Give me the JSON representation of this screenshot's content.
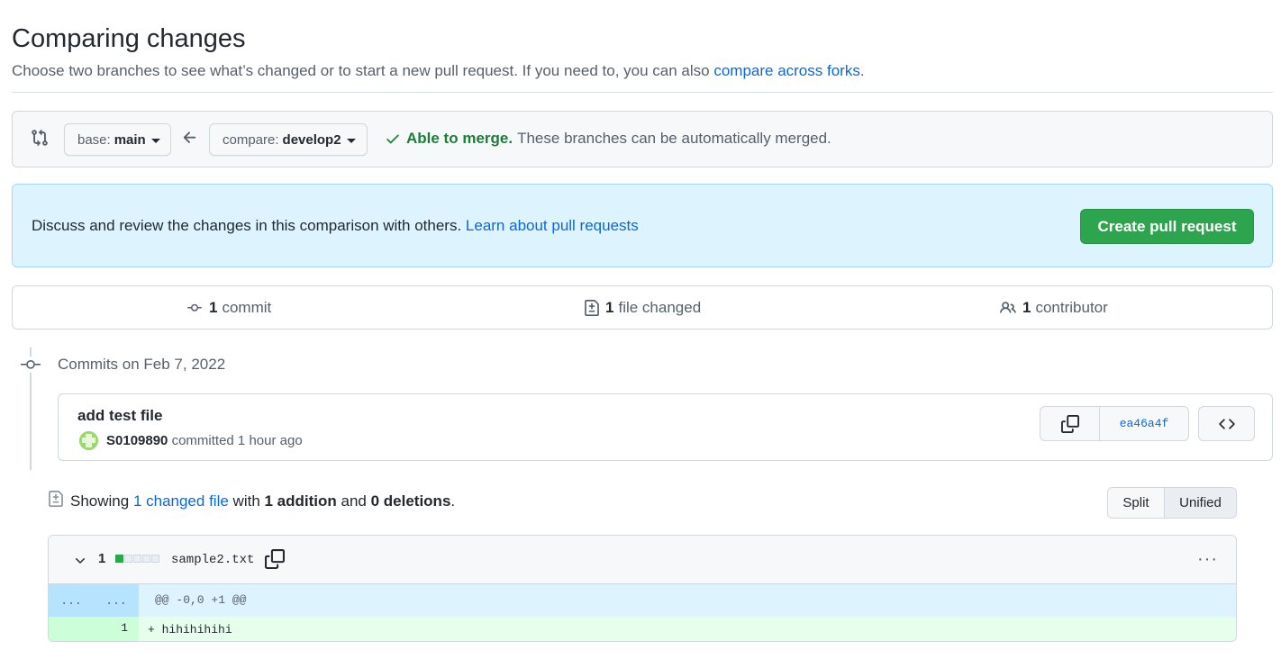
{
  "header": {
    "title": "Comparing changes",
    "subtitle": "Choose two branches to see what’s changed or to start a new pull request. If you need to, you can also ",
    "subtitle_link": "compare across forks",
    "subtitle_end": "."
  },
  "range": {
    "base_prefix": "base:",
    "base_branch": "main",
    "compare_prefix": "compare:",
    "compare_branch": "develop2",
    "merge_status": "Able to merge.",
    "merge_desc": "These branches can be automatically merged."
  },
  "pr_box": {
    "text": "Discuss and review the changes in this comparison with others. ",
    "link": "Learn about pull requests",
    "button": "Create pull request"
  },
  "stats": {
    "commits_count": "1",
    "commits_label": "commit",
    "files_count": "1",
    "files_label": "file changed",
    "contributors_count": "1",
    "contributors_label": "contributor"
  },
  "commits": {
    "date_heading": "Commits on Feb 7, 2022",
    "items": [
      {
        "title": "add test file",
        "author": "S0109890",
        "meta": "committed 1 hour ago",
        "sha": "ea46a4f"
      }
    ]
  },
  "toc": {
    "showing": "Showing ",
    "changed_link": "1 changed file",
    "with": " with ",
    "additions": "1 addition",
    "and": " and ",
    "deletions": "0 deletions",
    "end": ".",
    "view_split": "Split",
    "view_unified": "Unified"
  },
  "diff": {
    "files": [
      {
        "changes": "1",
        "filename": "sample2.txt",
        "hunk_old": "...",
        "hunk_new": "...",
        "hunk_header": "@@ -0,0 +1 @@",
        "lines": [
          {
            "new_num": "1",
            "text": "+ hihihihihi"
          }
        ]
      }
    ]
  },
  "colors": {
    "accent_green": "#2da44e",
    "link_blue": "#0969da",
    "merge_green": "#1a7f37"
  }
}
